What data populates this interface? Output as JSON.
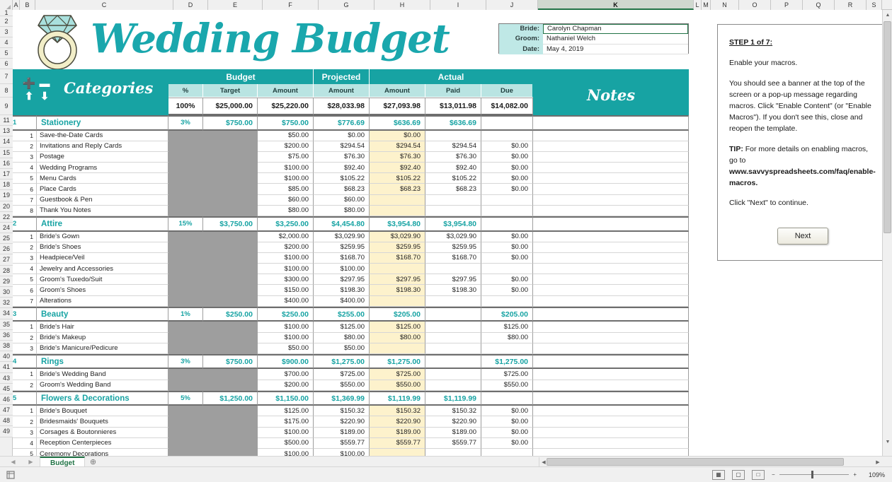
{
  "app": {
    "zoom_level": "109%",
    "sheet_tab": "Budget",
    "add_sheet_icon": "plus-circle-icon",
    "selected_column": "K"
  },
  "column_headers": [
    "A",
    "B",
    "C",
    "D",
    "E",
    "F",
    "G",
    "H",
    "I",
    "J",
    "K",
    "L",
    "M",
    "N",
    "O",
    "P",
    "Q",
    "R",
    "S"
  ],
  "row_headers": [
    "1",
    "2",
    "3",
    "4",
    "5",
    "6",
    "7",
    "8",
    "9",
    "11",
    "13",
    "14",
    "15",
    "16",
    "17",
    "18",
    "19",
    "20",
    "22",
    "24",
    "25",
    "26",
    "27",
    "28",
    "29",
    "30",
    "32",
    "34",
    "35",
    "36",
    "38",
    "40",
    "41",
    "43",
    "45",
    "46",
    "47",
    "48",
    "49"
  ],
  "title": {
    "text": "Wedding Budget",
    "logo_icon": "diamond-ring-icon",
    "accent_color": "#17a3a3"
  },
  "couple_info": {
    "rows": [
      {
        "label": "Bride:",
        "value": "Carolyn Chapman"
      },
      {
        "label": "Groom:",
        "value": "Nathaniel Welch"
      },
      {
        "label": "Date:",
        "value": "May 4, 2019"
      }
    ]
  },
  "table": {
    "group_headers": {
      "categories": "Categories",
      "budget": "Budget",
      "projected": "Projected",
      "actual": "Actual",
      "notes": "Notes"
    },
    "category_icons": [
      "plus-icon",
      "minus-icon",
      "move-up-icon",
      "move-down-icon"
    ],
    "sub_headers": {
      "pct": "%",
      "target": "Target",
      "budget_amount": "Amount",
      "projected_amount": "Amount",
      "actual_amount": "Amount",
      "paid": "Paid",
      "due": "Due"
    },
    "totals": {
      "pct": "100%",
      "target": "$25,000.00",
      "budget_amount": "$25,220.00",
      "projected_amount": "$28,033.98",
      "actual_amount": "$27,093.98",
      "paid": "$13,011.98",
      "due": "$14,082.00"
    },
    "categories": [
      {
        "num": "1",
        "name": "Stationery",
        "pct": "3%",
        "target": "$750.00",
        "budget": "$750.00",
        "projected": "$776.69",
        "actual": "$636.69",
        "paid": "$636.69",
        "due": "",
        "items": [
          {
            "num": "1",
            "name": "Save-the-Date Cards",
            "budget": "$50.00",
            "projected": "$0.00",
            "actual": "$0.00",
            "paid": "",
            "due": ""
          },
          {
            "num": "2",
            "name": "Invitations and Reply Cards",
            "budget": "$200.00",
            "projected": "$294.54",
            "actual": "$294.54",
            "paid": "$294.54",
            "due": "$0.00"
          },
          {
            "num": "3",
            "name": "Postage",
            "budget": "$75.00",
            "projected": "$76.30",
            "actual": "$76.30",
            "paid": "$76.30",
            "due": "$0.00"
          },
          {
            "num": "4",
            "name": "Wedding Programs",
            "budget": "$100.00",
            "projected": "$92.40",
            "actual": "$92.40",
            "paid": "$92.40",
            "due": "$0.00"
          },
          {
            "num": "5",
            "name": "Menu Cards",
            "budget": "$100.00",
            "projected": "$105.22",
            "actual": "$105.22",
            "paid": "$105.22",
            "due": "$0.00"
          },
          {
            "num": "6",
            "name": "Place Cards",
            "budget": "$85.00",
            "projected": "$68.23",
            "actual": "$68.23",
            "paid": "$68.23",
            "due": "$0.00"
          },
          {
            "num": "7",
            "name": "Guestbook & Pen",
            "budget": "$60.00",
            "projected": "$60.00",
            "actual": "",
            "paid": "",
            "due": ""
          },
          {
            "num": "8",
            "name": "Thank You Notes",
            "budget": "$80.00",
            "projected": "$80.00",
            "actual": "",
            "paid": "",
            "due": ""
          }
        ]
      },
      {
        "num": "2",
        "name": "Attire",
        "pct": "15%",
        "target": "$3,750.00",
        "budget": "$3,250.00",
        "projected": "$4,454.80",
        "actual": "$3,954.80",
        "paid": "$3,954.80",
        "due": "",
        "items": [
          {
            "num": "1",
            "name": "Bride's Gown",
            "budget": "$2,000.00",
            "projected": "$3,029.90",
            "actual": "$3,029.90",
            "paid": "$3,029.90",
            "due": "$0.00"
          },
          {
            "num": "2",
            "name": "Bride's Shoes",
            "budget": "$200.00",
            "projected": "$259.95",
            "actual": "$259.95",
            "paid": "$259.95",
            "due": "$0.00"
          },
          {
            "num": "3",
            "name": "Headpiece/Veil",
            "budget": "$100.00",
            "projected": "$168.70",
            "actual": "$168.70",
            "paid": "$168.70",
            "due": "$0.00"
          },
          {
            "num": "4",
            "name": "Jewelry and Accessories",
            "budget": "$100.00",
            "projected": "$100.00",
            "actual": "",
            "paid": "",
            "due": ""
          },
          {
            "num": "5",
            "name": "Groom's Tuxedo/Suit",
            "budget": "$300.00",
            "projected": "$297.95",
            "actual": "$297.95",
            "paid": "$297.95",
            "due": "$0.00"
          },
          {
            "num": "6",
            "name": "Groom's Shoes",
            "budget": "$150.00",
            "projected": "$198.30",
            "actual": "$198.30",
            "paid": "$198.30",
            "due": "$0.00"
          },
          {
            "num": "7",
            "name": "Alterations",
            "budget": "$400.00",
            "projected": "$400.00",
            "actual": "",
            "paid": "",
            "due": ""
          }
        ]
      },
      {
        "num": "3",
        "name": "Beauty",
        "pct": "1%",
        "target": "$250.00",
        "budget": "$250.00",
        "projected": "$255.00",
        "actual": "$205.00",
        "paid": "",
        "due": "$205.00",
        "items": [
          {
            "num": "1",
            "name": "Bride's Hair",
            "budget": "$100.00",
            "projected": "$125.00",
            "actual": "$125.00",
            "paid": "",
            "due": "$125.00"
          },
          {
            "num": "2",
            "name": "Bride's Makeup",
            "budget": "$100.00",
            "projected": "$80.00",
            "actual": "$80.00",
            "paid": "",
            "due": "$80.00"
          },
          {
            "num": "3",
            "name": "Bride's Manicure/Pedicure",
            "budget": "$50.00",
            "projected": "$50.00",
            "actual": "",
            "paid": "",
            "due": ""
          }
        ]
      },
      {
        "num": "4",
        "name": "Rings",
        "pct": "3%",
        "target": "$750.00",
        "budget": "$900.00",
        "projected": "$1,275.00",
        "actual": "$1,275.00",
        "paid": "",
        "due": "$1,275.00",
        "items": [
          {
            "num": "1",
            "name": "Bride's Wedding Band",
            "budget": "$700.00",
            "projected": "$725.00",
            "actual": "$725.00",
            "paid": "",
            "due": "$725.00"
          },
          {
            "num": "2",
            "name": "Groom's Wedding Band",
            "budget": "$200.00",
            "projected": "$550.00",
            "actual": "$550.00",
            "paid": "",
            "due": "$550.00"
          }
        ]
      },
      {
        "num": "5",
        "name": "Flowers & Decorations",
        "pct": "5%",
        "target": "$1,250.00",
        "budget": "$1,150.00",
        "projected": "$1,369.99",
        "actual": "$1,119.99",
        "paid": "$1,119.99",
        "due": "",
        "items": [
          {
            "num": "1",
            "name": "Bride's Bouquet",
            "budget": "$125.00",
            "projected": "$150.32",
            "actual": "$150.32",
            "paid": "$150.32",
            "due": "$0.00"
          },
          {
            "num": "2",
            "name": "Bridesmaids' Bouquets",
            "budget": "$175.00",
            "projected": "$220.90",
            "actual": "$220.90",
            "paid": "$220.90",
            "due": "$0.00"
          },
          {
            "num": "3",
            "name": "Corsages & Boutonnieres",
            "budget": "$100.00",
            "projected": "$189.00",
            "actual": "$189.00",
            "paid": "$189.00",
            "due": "$0.00"
          },
          {
            "num": "4",
            "name": "Reception Centerpieces",
            "budget": "$500.00",
            "projected": "$559.77",
            "actual": "$559.77",
            "paid": "$559.77",
            "due": "$0.00"
          },
          {
            "num": "5",
            "name": "Ceremony Decorations",
            "budget": "$100.00",
            "projected": "$100.00",
            "actual": "",
            "paid": "",
            "due": ""
          }
        ]
      }
    ]
  },
  "macro_panel": {
    "step_title": "STEP 1 of 7:",
    "line1": "Enable your macros.",
    "line2": "You should see a banner at the top of the screen or a pop-up message regarding macros.  Click \"Enable Content\" (or \"Enable Macros\").  If you don't see this, close and reopen the template.",
    "tip_label": "TIP:",
    "tip_text": "  For more details on enabling macros, go to ",
    "tip_url": "www.savvyspreadsheets.com/faq/enable-macros.",
    "line3": "Click \"Next\" to continue.",
    "next_button": "Next"
  }
}
